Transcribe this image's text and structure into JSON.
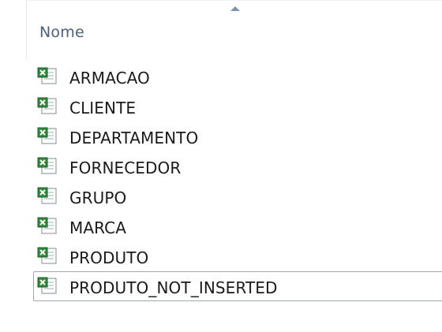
{
  "column_header": {
    "name_label": "Nome",
    "sort_direction": "ascending"
  },
  "files": [
    {
      "name": "ARMACAO",
      "icon": "excel-csv-file-icon",
      "selected": false
    },
    {
      "name": "CLIENTE",
      "icon": "excel-csv-file-icon",
      "selected": false
    },
    {
      "name": "DEPARTAMENTO",
      "icon": "excel-csv-file-icon",
      "selected": false
    },
    {
      "name": "FORNECEDOR",
      "icon": "excel-csv-file-icon",
      "selected": false
    },
    {
      "name": "GRUPO",
      "icon": "excel-csv-file-icon",
      "selected": false
    },
    {
      "name": "MARCA",
      "icon": "excel-csv-file-icon",
      "selected": false
    },
    {
      "name": "PRODUTO",
      "icon": "excel-csv-file-icon",
      "selected": false
    },
    {
      "name": "PRODUTO_NOT_INSERTED",
      "icon": "excel-csv-file-icon",
      "selected": true
    }
  ],
  "colors": {
    "header_text": "#4c607a",
    "selection_border": "#a0a8b4",
    "excel_green": "#2f8a3a"
  }
}
